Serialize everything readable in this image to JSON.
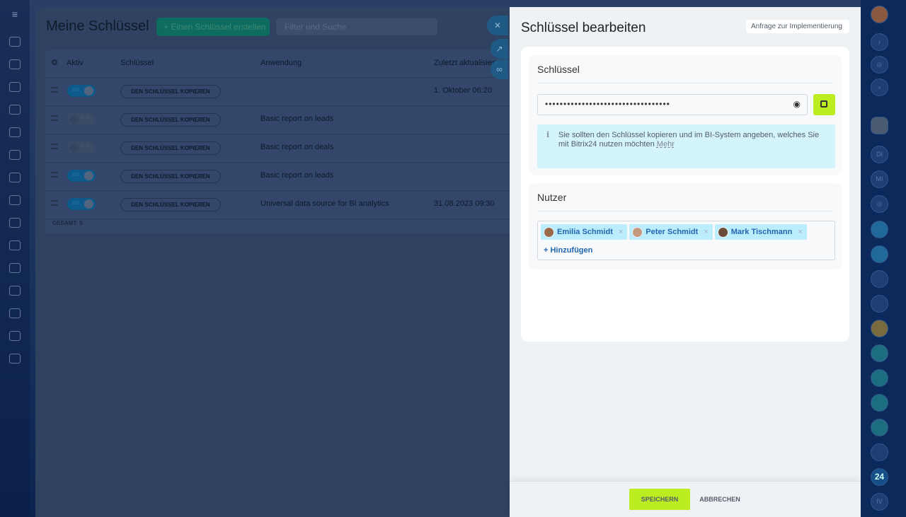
{
  "main": {
    "title": "Meine Schlüssel",
    "create_label": "Einen Schlüssel erstellen",
    "filter_placeholder": "Filter und Suche",
    "columns": {
      "active": "Aktiv",
      "key": "Schlüssel",
      "app": "Anwendung",
      "updated": "Zuletzt aktualisiert"
    },
    "rows": [
      {
        "toggle": "EIN",
        "on": true,
        "copy": "DEN SCHLÜSSEL KOPIEREN",
        "app": "",
        "updated": "1. Oktober 06:20"
      },
      {
        "toggle": "AUS",
        "on": false,
        "copy": "DEN SCHLÜSSEL KOPIEREN",
        "app": "Basic report on leads",
        "updated": ""
      },
      {
        "toggle": "AUS",
        "on": false,
        "copy": "DEN SCHLÜSSEL KOPIEREN",
        "app": "Basic report on deals",
        "updated": ""
      },
      {
        "toggle": "EIN",
        "on": true,
        "copy": "DEN SCHLÜSSEL KOPIEREN",
        "app": "Basic report on leads",
        "updated": ""
      },
      {
        "toggle": "EIN",
        "on": true,
        "copy": "DEN SCHLÜSSEL KOPIEREN",
        "app": "Universal data source for BI analytics",
        "updated": "31.08.2023 09:30"
      }
    ],
    "total_label": "GESAMT:",
    "total": "5"
  },
  "panel": {
    "title": "Schlüssel bearbeiten",
    "impl_button": "Anfrage zur Implementierung",
    "key_section": "Schlüssel",
    "key_value": "••••••••••••••••••••••••••••••••••",
    "info": "Sie sollten den Schlüssel kopieren und im BI-System angeben, welches Sie mit Bitrix24 nutzen möchten",
    "info_link": "Mehr",
    "users_section": "Nutzer",
    "users": [
      "Emilia Schmidt",
      "Peter Schmidt",
      "Mark Tischmann"
    ],
    "add_label": "+ Hinzufügen",
    "save": "SPEICHERN",
    "cancel": "ABBRECHEN"
  },
  "right_sidebar": {
    "badges": [
      "DI",
      "MI",
      "24",
      "IV"
    ]
  },
  "colors": {
    "accent": "#bbed21",
    "chip": "#bcedfc",
    "info_bg": "#d3f3fd"
  }
}
